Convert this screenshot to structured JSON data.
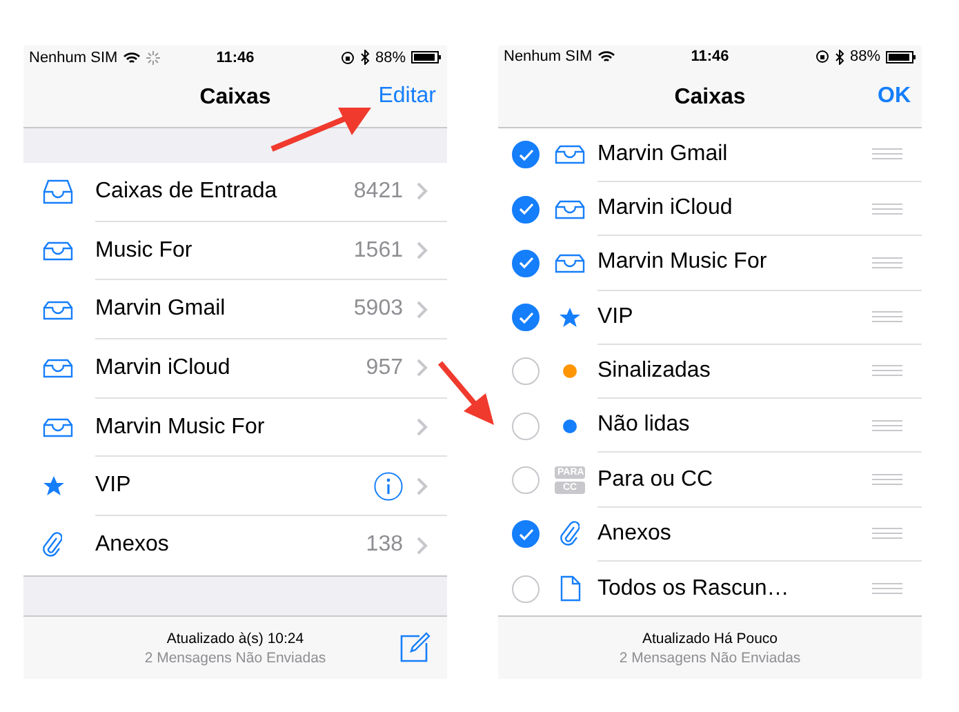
{
  "screens": [
    {
      "status_bar": {
        "carrier": "Nenhum SIM",
        "loading": true,
        "time": "11:46",
        "battery": "88%"
      },
      "kind": "browse",
      "nav": {
        "title": "Caixas",
        "action": "Editar"
      },
      "rows": [
        {
          "label": "Caixas de Entrada",
          "count": "8421",
          "info": false
        },
        {
          "label": "Music For",
          "count": "1561",
          "info": false
        },
        {
          "label": "Marvin Gmail",
          "count": "5903",
          "info": false
        },
        {
          "label": "Marvin iCloud",
          "count": "957",
          "info": false
        },
        {
          "label": "Marvin Music For",
          "info": false
        },
        {
          "label": "VIP",
          "info": true
        },
        {
          "label": "Anexos",
          "count": "138",
          "info": false
        }
      ],
      "toolbar": {
        "status": "Atualizado à(s) 10:24",
        "detail": "2 Mensagens Não Enviadas",
        "compose": true
      }
    },
    {
      "status_bar": {
        "carrier": "Nenhum SIM",
        "loading": false,
        "time": "11:46",
        "battery": "88%"
      },
      "kind": "edit",
      "nav": {
        "title": "Caixas",
        "action": "OK"
      },
      "rows": [
        {
          "label": "Marvin Gmail",
          "checked": true
        },
        {
          "label": "Marvin iCloud",
          "checked": true
        },
        {
          "label": "Marvin Music For",
          "checked": true
        },
        {
          "label": "VIP",
          "checked": true
        },
        {
          "label": "Sinalizadas",
          "checked": false,
          "color": "#ff9500"
        },
        {
          "label": "Não lidas",
          "checked": false,
          "color": "#157efb"
        },
        {
          "label": "Para ou CC",
          "badge_top": "PARA",
          "badge_bottom": "CC",
          "checked": false
        },
        {
          "label": "Anexos",
          "checked": true
        },
        {
          "label": "Todos os Rascun…",
          "checked": false
        }
      ],
      "toolbar": {
        "status": "Atualizado Há Pouco",
        "detail": "2 Mensagens Não Enviadas",
        "compose": false
      }
    }
  ]
}
